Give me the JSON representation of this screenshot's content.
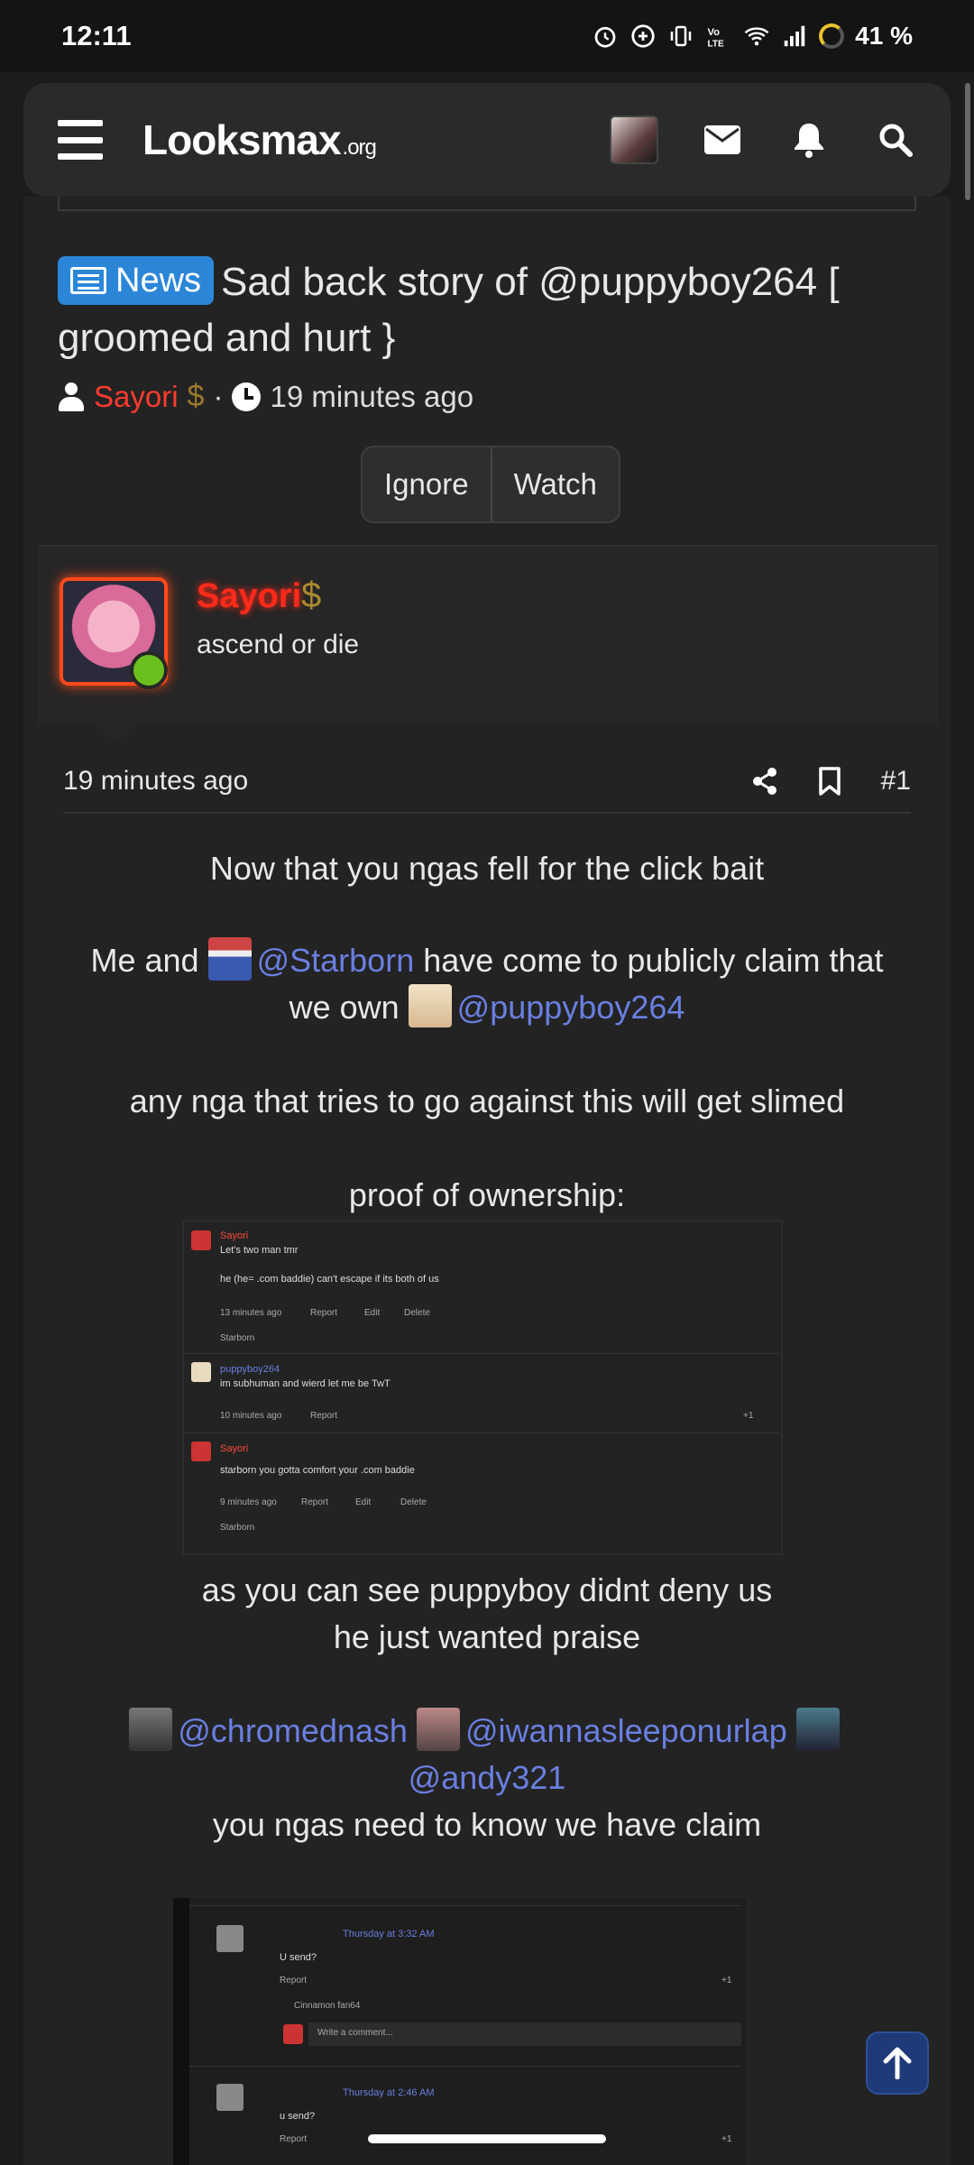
{
  "status": {
    "time": "12:11",
    "battery": "41 %"
  },
  "header": {
    "logo_main": "Looksmax",
    "logo_suffix": ".org"
  },
  "thread": {
    "badge": "News",
    "title": "Sad back story of @puppyboy264 [ groomed and hurt }",
    "author": "Sayori",
    "author_badge": "$",
    "separator": "·",
    "time": "19 minutes ago",
    "ignore_label": "Ignore",
    "watch_label": "Watch"
  },
  "post": {
    "username": "Sayori",
    "user_badge": "$",
    "user_title": "ascend or die",
    "time": "19 minutes ago",
    "number": "#1",
    "lines": {
      "l1": "Now that you ngas fell for the click bait",
      "l2a": "Me and",
      "l2m": "@Starborn",
      "l2b": "have come to publicly claim that",
      "l3a": "we own",
      "l3m": "@puppyboy264",
      "l4": "any nga that tries to go against this will get slimed",
      "l5": "proof of ownership:",
      "l6": "as you can see puppyboy didnt deny us",
      "l7": "he just wanted praise",
      "m1": "@chromednash",
      "m2": "@iwannasleeponurlap",
      "m3": "@andy321",
      "l8": "you ngas need to know we have claim"
    }
  },
  "shot1": {
    "c1_user": "Sayori",
    "c1_text1": "Let's two man tmr",
    "c1_text2": "he (he= .com baddie) can't escape if its both of us",
    "c1_meta": "13 minutes ago",
    "report": "Report",
    "edit": "Edit",
    "delete": "Delete",
    "c1_react": "Starborn",
    "c2_user": "puppyboy264",
    "c2_text": "im subhuman and wierd let me be TwT",
    "c2_meta": "10 minutes ago",
    "c2_like": "+1",
    "c3_user": "Sayori",
    "c3_text": "starborn you gotta comfort your .com baddie",
    "c3_meta": "9 minutes ago",
    "c3_react": "Starborn"
  },
  "shot2": {
    "c1_time": "Thursday at 3:32 AM",
    "c1_text": "U send?",
    "report": "Report",
    "like": "+1",
    "sub_user": "Cinnamon fan64",
    "write": "Write a comment...",
    "c2_time": "Thursday at 2:46 AM",
    "c2_text": "u send?"
  }
}
